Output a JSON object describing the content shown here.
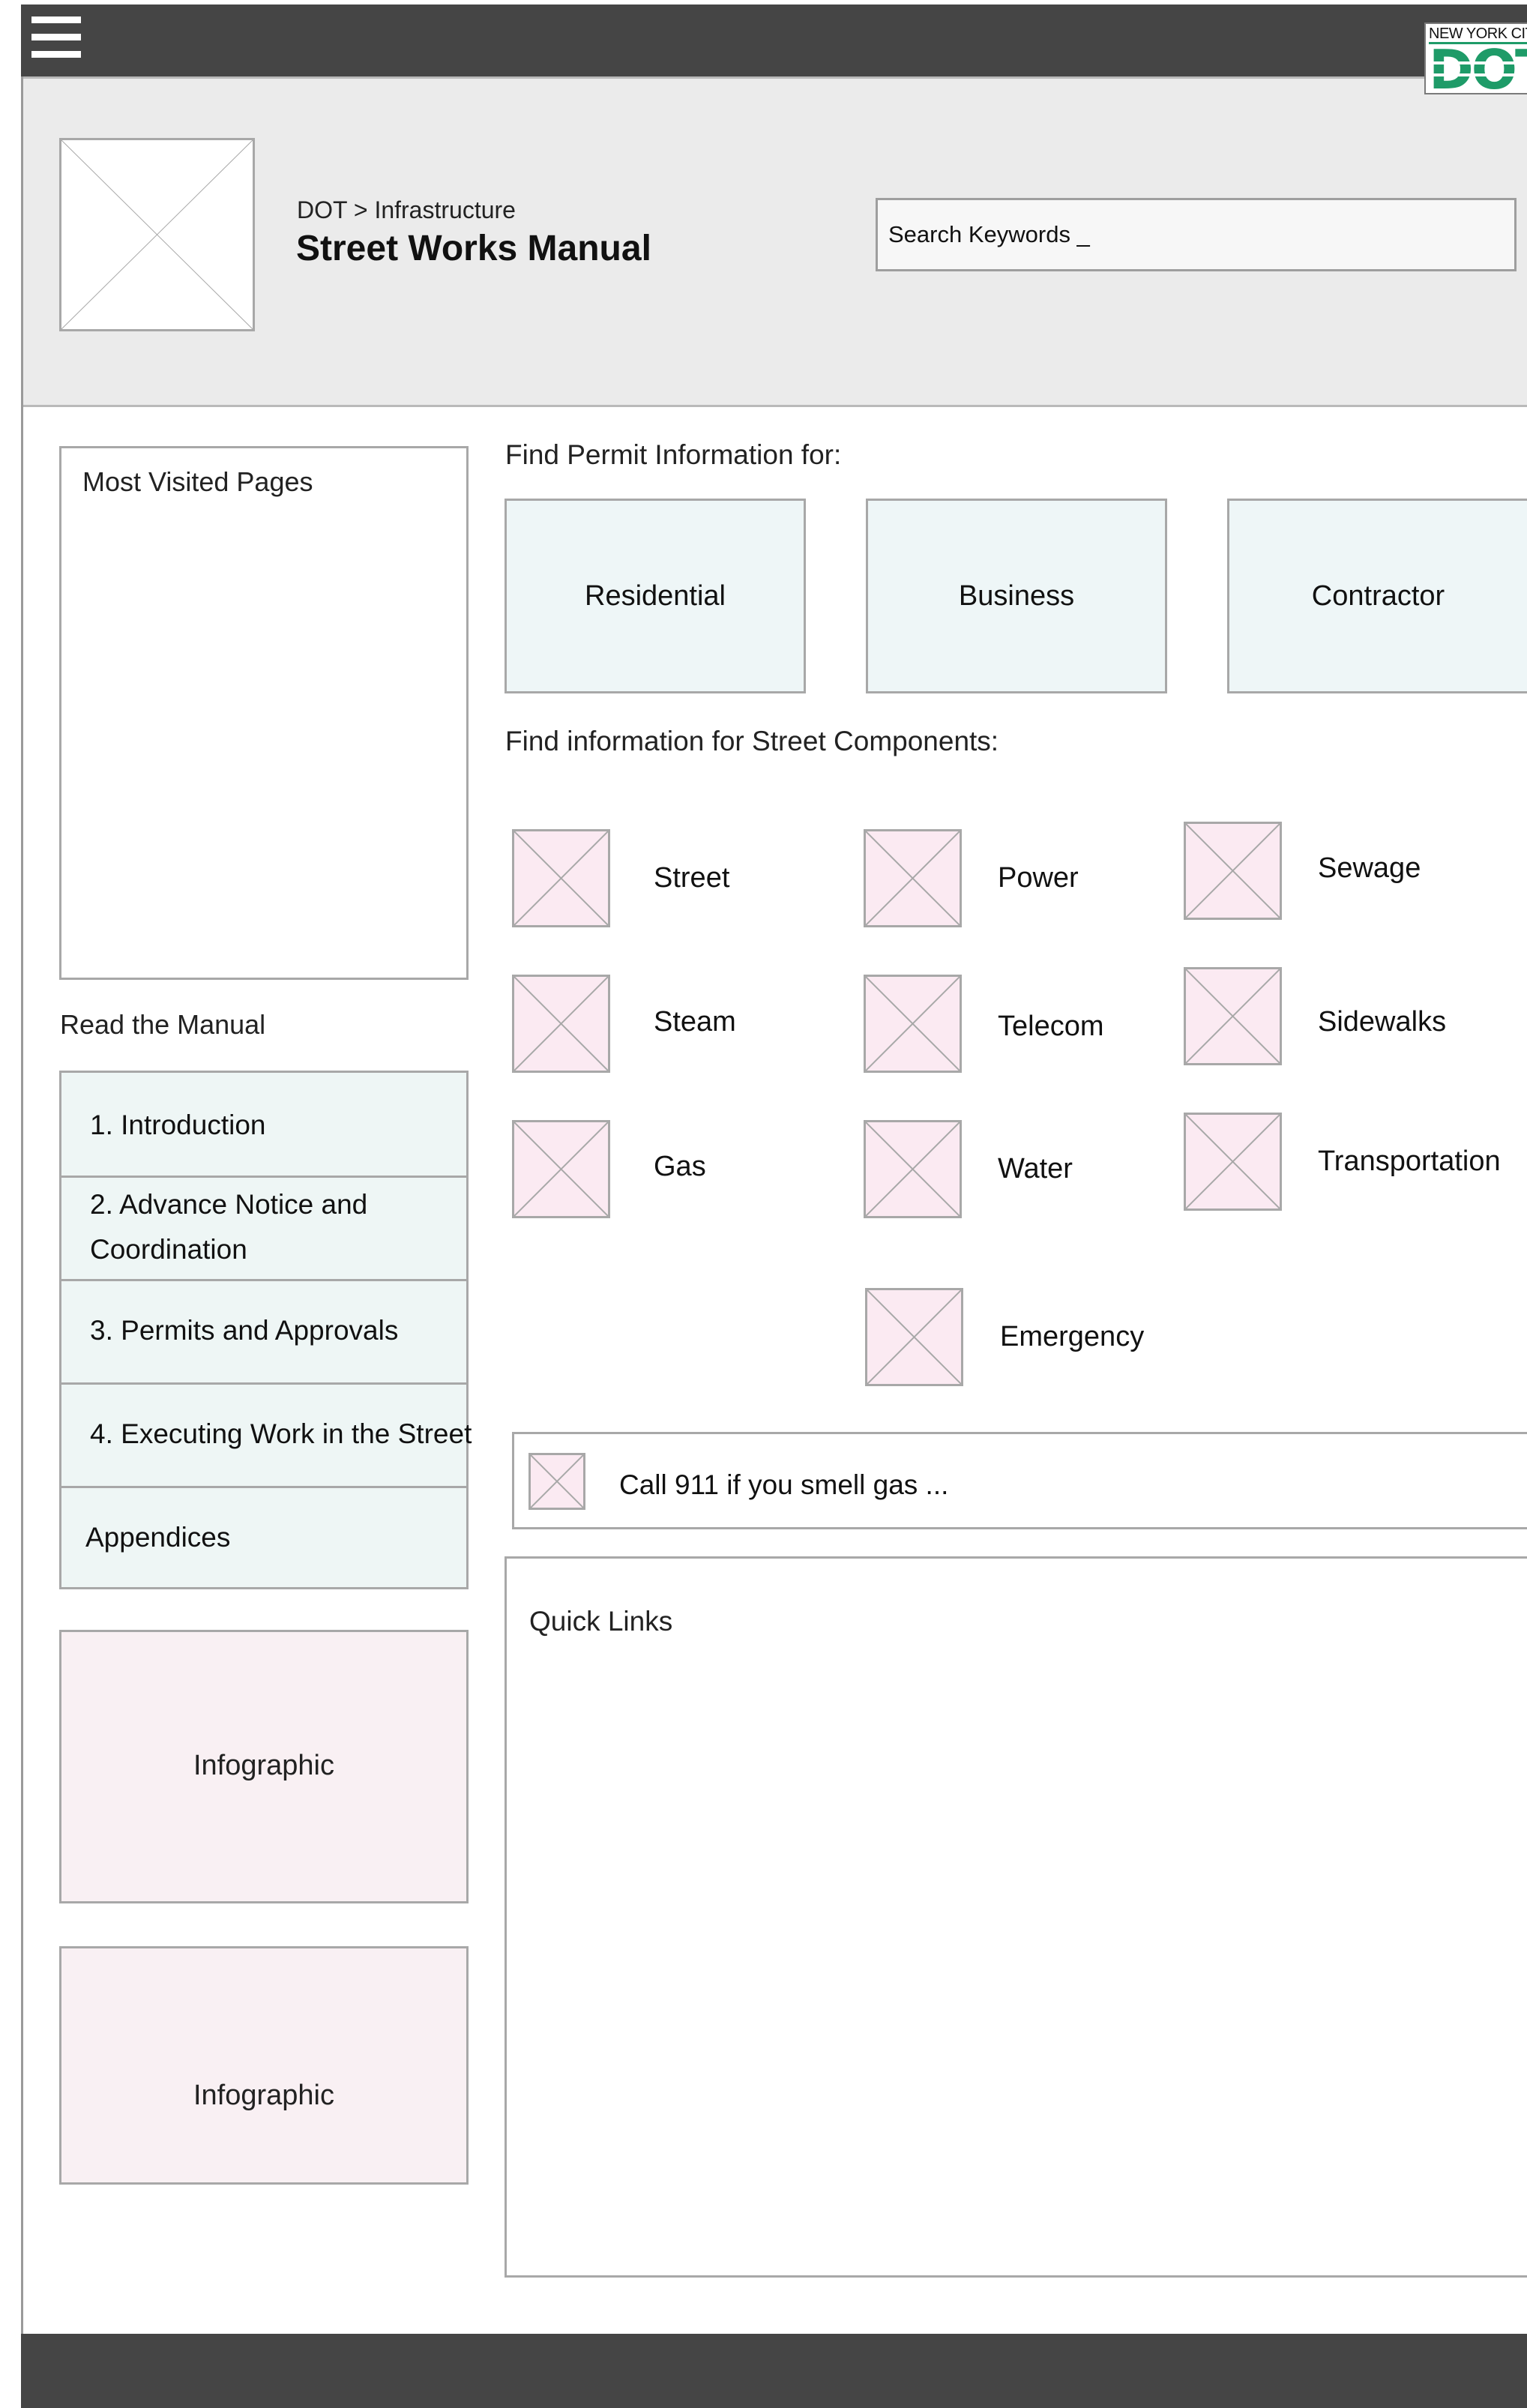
{
  "logo": {
    "text": "NEW YORK CITY",
    "mark": "DOT"
  },
  "header": {
    "breadcrumb": "DOT > Infrastructure",
    "title": "Street Works Manual",
    "search_value": "Search Keywords _"
  },
  "sidebar": {
    "most_visited_title": "Most Visited Pages",
    "read_title": "Read the Manual",
    "manual_items": [
      {
        "label": "1. Introduction"
      },
      {
        "label_line1": "2. Advance Notice and",
        "label_line2": "Coordination"
      },
      {
        "label": "3. Permits and Approvals"
      },
      {
        "label": "4. Executing Work in the Street"
      },
      {
        "label": "Appendices"
      }
    ],
    "infographics": [
      "Infographic",
      "Infographic"
    ]
  },
  "permits": {
    "title": "Find Permit Information for:",
    "buttons": [
      "Residential",
      "Business",
      "Contractor"
    ]
  },
  "components": {
    "title": "Find information for Street Components:",
    "items": [
      "Street",
      "Power",
      "Sewage",
      "Steam",
      "Telecom",
      "Sidewalks",
      "Gas",
      "Water",
      "Transportation",
      "Emergency"
    ]
  },
  "alert": {
    "text": "Call 911 if you smell gas ..."
  },
  "quick_links": {
    "title": "Quick Links"
  },
  "colors": {
    "topbar": "#454545",
    "header_bg": "#ebebeb",
    "permit_bg": "#eef6f7",
    "component_bg": "#fbeaf2",
    "infographic_bg": "#f9f0f3",
    "logo_green": "#1e9b68"
  }
}
